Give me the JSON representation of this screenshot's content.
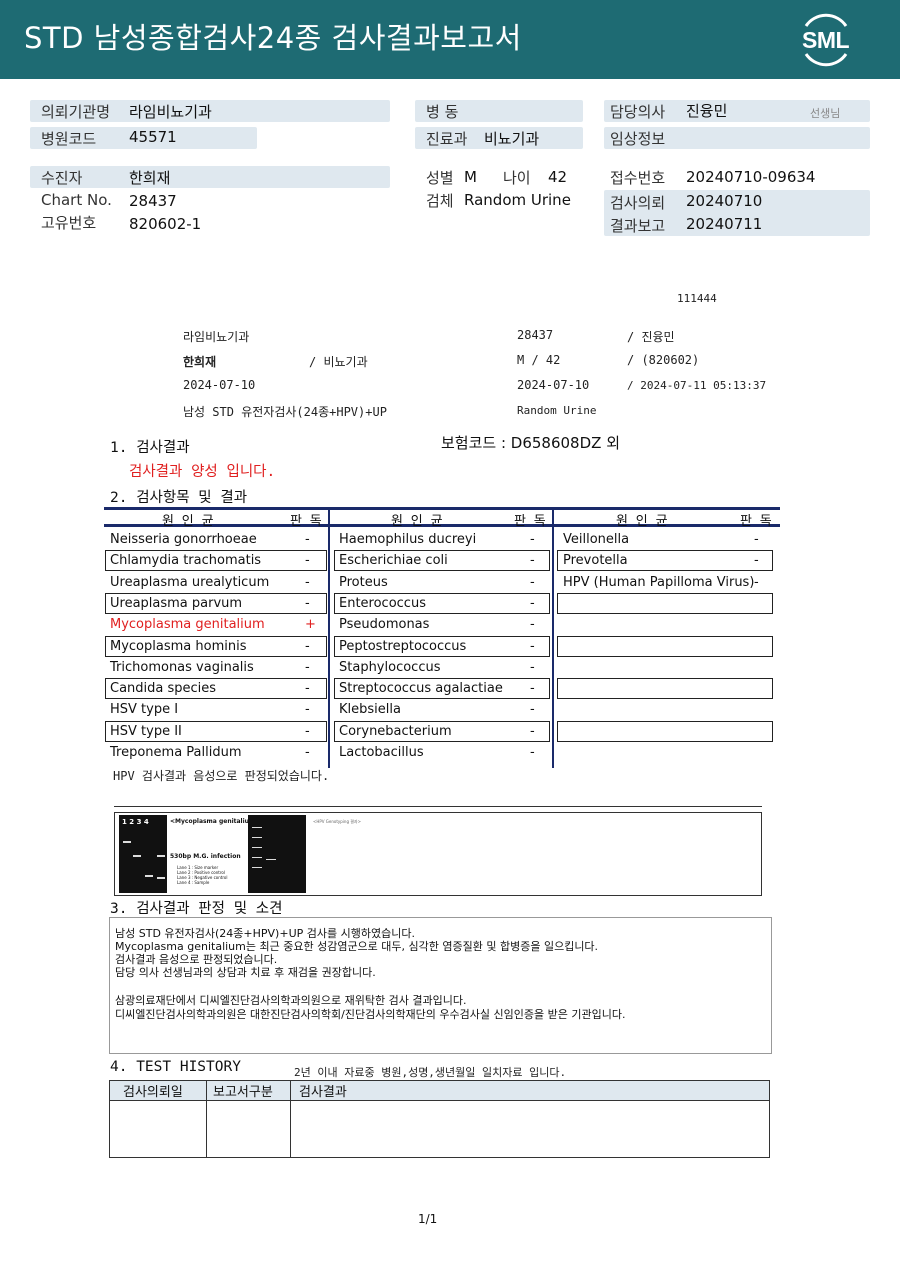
{
  "header": {
    "title": "STD 남성종합검사24종 검사결과보고서",
    "logo_text": "SML"
  },
  "patient_info": {
    "institution_label": "의뢰기관명",
    "institution_value": "라임비뇨기과",
    "hospital_code_label": "병원코드",
    "hospital_code_value": "45571",
    "ward_label": "병 동",
    "ward_value": "",
    "dept_label": "진료과",
    "dept_value": "비뇨기과",
    "doctor_label": "담당의사",
    "doctor_value": "진융민",
    "doctor_suffix": "선생님",
    "clinical_label": "임상정보",
    "clinical_value": "",
    "examinee_label": "수진자",
    "examinee_value": "한희재",
    "chart_label": "Chart No.",
    "chart_value": "28437",
    "unique_label": "고유번호",
    "unique_value": "820602-1",
    "sex_label": "성별",
    "sex_value": "M",
    "age_label": "나이",
    "age_value": "42",
    "specimen_label": "검체",
    "specimen_value": "Random Urine",
    "receipt_label": "접수번호",
    "receipt_value": "20240710-09634",
    "request_label": "검사의뢰",
    "request_value": "20240710",
    "report_label": "결과보고",
    "report_value": "20240711"
  },
  "mid_block": {
    "code": "111444",
    "institution": "라임비뇨기과",
    "chart": "28437",
    "doctor": "/ 진융민",
    "name": "한희재",
    "dept": "/ 비뇨기과",
    "sex_age": "M  /  42",
    "birth": "/ (820602)",
    "date1": "2024-07-10",
    "date2": "2024-07-10",
    "datetime": "/ 2024-07-11 05:13:37",
    "test_name": "남성 STD 유전자검사(24종+HPV)+UP",
    "specimen": "Random Urine"
  },
  "section1": {
    "title": "1. 검사결과",
    "insurance": "보험코드 : D658608DZ 외",
    "result": "검사결과 양성 입니다."
  },
  "section2": {
    "title": "2. 검사항목 및 결과",
    "col_pathogen": "원   인   균",
    "col_judgement": "판 독",
    "columns": [
      [
        {
          "name": "Neisseria gonorrhoeae",
          "result": "-"
        },
        {
          "name": "Chlamydia trachomatis",
          "result": "-"
        },
        {
          "name": "Ureaplasma urealyticum",
          "result": "-"
        },
        {
          "name": "Ureaplasma parvum",
          "result": "-"
        },
        {
          "name": "Mycoplasma genitalium",
          "result": "+"
        },
        {
          "name": "Mycoplasma hominis",
          "result": "-"
        },
        {
          "name": "Trichomonas vaginalis",
          "result": "-"
        },
        {
          "name": "Candida species",
          "result": "-"
        },
        {
          "name": "HSV type I",
          "result": "-"
        },
        {
          "name": "HSV type II",
          "result": "-"
        },
        {
          "name": "Treponema Pallidum",
          "result": "-"
        }
      ],
      [
        {
          "name": "Haemophilus ducreyi",
          "result": "-"
        },
        {
          "name": "Escherichiae coli",
          "result": "-"
        },
        {
          "name": "Proteus",
          "result": "-"
        },
        {
          "name": "Enterococcus",
          "result": "-"
        },
        {
          "name": "Pseudomonas",
          "result": "-"
        },
        {
          "name": "Peptostreptococcus",
          "result": "-"
        },
        {
          "name": "Staphylococcus",
          "result": "-"
        },
        {
          "name": "Streptococcus agalactiae",
          "result": "-"
        },
        {
          "name": "Klebsiella",
          "result": "-"
        },
        {
          "name": "Corynebacterium",
          "result": "-"
        },
        {
          "name": "Lactobacillus",
          "result": "-"
        }
      ],
      [
        {
          "name": "Veillonella",
          "result": "-"
        },
        {
          "name": "Prevotella",
          "result": "-"
        },
        {
          "name": "HPV (Human Papilloma Virus)",
          "result": "-"
        }
      ]
    ],
    "hpv_note": "HPV 검사결과 음성으로 판정되었습니다."
  },
  "gel": {
    "lanes": "1  2  3  4",
    "title": "<Mycoplasma genitalium>",
    "infection_label": "530bp M.G. infection",
    "legend": [
      "Lane 1 : Size marker",
      "Lane 2 : Positive control",
      "Lane 3 : Negative control",
      "Lane 4 : Sample"
    ],
    "hpv_title": "<HPV Genotyping 결과>"
  },
  "section3": {
    "title": "3. 검사결과 판정 및 소견",
    "lines": [
      "남성 STD 유전자검사(24종+HPV)+UP 검사를 시행하였습니다.",
      "Mycoplasma genitalium는 최근 중요한 성감염군으로 대두, 심각한 염증질환 및 합병증을 일으킵니다.",
      "검사결과 음성으로 판정되었습니다.",
      "담당 의사 선생님과의 상담과 치료 후 재검을 권장합니다.",
      "",
      "삼광의료재단에서 디씨엘진단검사의학과의원으로 재위탁한 검사 결과입니다.",
      "디씨엘진단검사의학과의원은 대한진단검사의학회/진단검사의학재단의 우수검사실 신임인증을 받은 기관입니다."
    ]
  },
  "section4": {
    "title": "4. TEST HISTORY",
    "note": "2년 이내 자료중 병원,성명,생년월일 일치자료 입니다.",
    "col1": "검사의뢰일",
    "col2": "보고서구분",
    "col3": "검사결과"
  },
  "footer": {
    "page": "1/1"
  }
}
